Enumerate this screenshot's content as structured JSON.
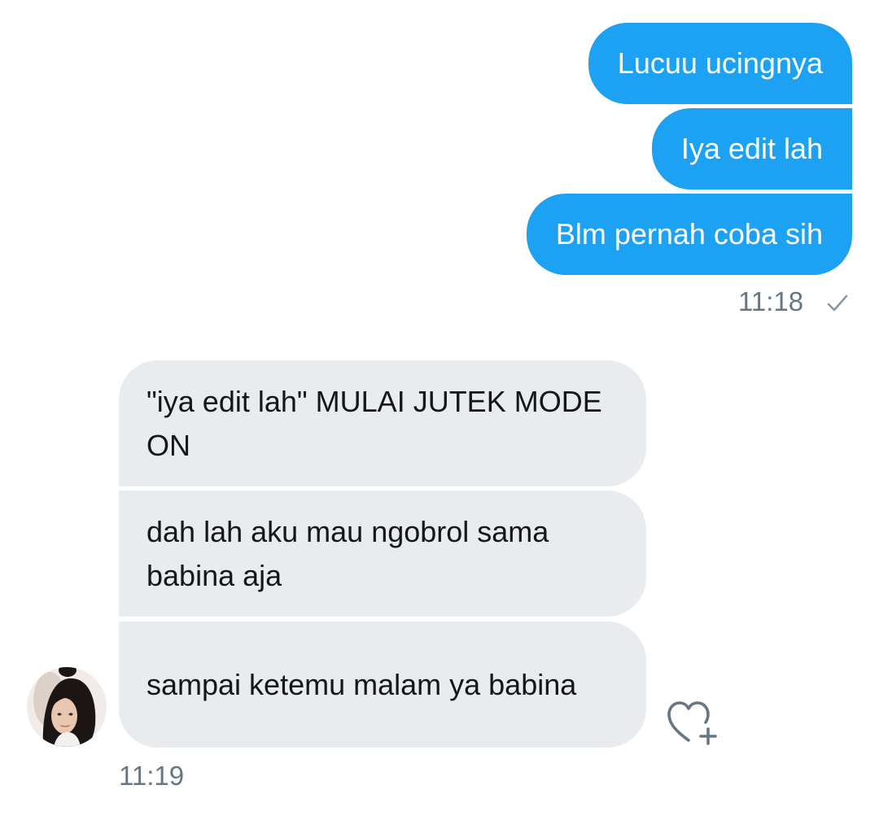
{
  "conversation": {
    "outgoing": [
      {
        "text": "Lucuu ucingnya"
      },
      {
        "text": "Iya edit lah"
      },
      {
        "text": "Blm pernah coba sih"
      }
    ],
    "outgoing_time": "11:18",
    "incoming": [
      {
        "text": "\"iya edit lah\" MULAI JUTEK MODE ON"
      },
      {
        "text": "dah lah aku mau ngobrol sama babina aja"
      },
      {
        "text": "sampai ketemu malam ya babina"
      }
    ],
    "incoming_time": "11:19"
  },
  "icons": {
    "read_status": "checkmark-icon",
    "like": "heart-plus-icon",
    "avatar": "user-avatar"
  },
  "colors": {
    "outgoing_bubble": "#1da1f2",
    "incoming_bubble": "#e9ecef",
    "timestamp": "#657786"
  }
}
